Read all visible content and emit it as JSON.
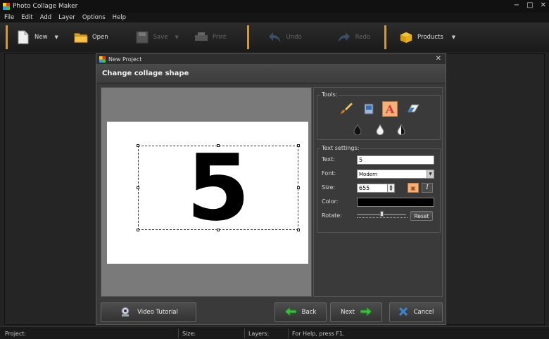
{
  "window": {
    "title": "Photo Collage Maker",
    "controls": [
      "−",
      "□",
      "✕"
    ]
  },
  "menu": [
    "File",
    "Edit",
    "Add",
    "Layer",
    "Options",
    "Help"
  ],
  "toolbar": {
    "new": "New",
    "open": "Open",
    "save": "Save",
    "print": "Print",
    "undo": "Undo",
    "redo": "Redo",
    "products": "Products"
  },
  "dialog": {
    "title": "New Project",
    "close": "✕",
    "heading": "Change collage shape",
    "preview": {
      "text": "5"
    },
    "tools": {
      "label": "Tools:"
    },
    "text_settings": {
      "label": "Text settings:",
      "text_label": "Text:",
      "text_value": "5",
      "font_label": "Font:",
      "font_value": "Modern",
      "size_label": "Size:",
      "size_value": "655",
      "color_label": "Color:",
      "color_value": "#000000",
      "rotate_label": "Rotate:",
      "reset": "Reset",
      "italic": "I"
    },
    "buttons": {
      "video": "Video Tutorial",
      "back": "Back",
      "next": "Next",
      "cancel": "Cancel"
    }
  },
  "status": {
    "project": "Project:",
    "size": "Size:",
    "layers": "Layers:",
    "help": "For Help, press F1."
  },
  "colors": {
    "accent": "#d09a3a",
    "active_tool": "#f2b27a",
    "arrow_green": "#3bbf3b",
    "cancel_blue": "#3a86d8"
  }
}
